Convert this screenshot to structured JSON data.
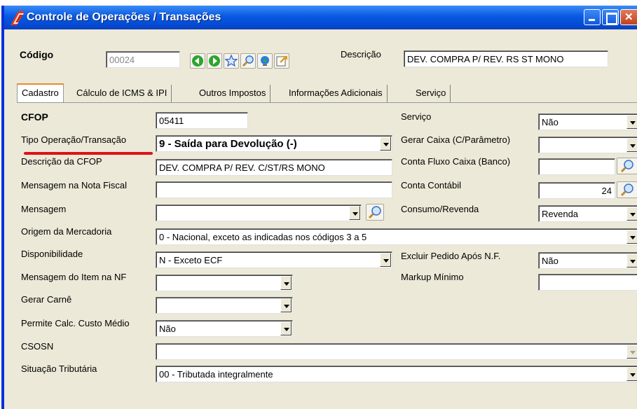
{
  "window": {
    "title": "Controle de Operações / Transações"
  },
  "header": {
    "codigo_label": "Código",
    "codigo_value": "00024",
    "descricao_label": "Descrição",
    "descricao_value": "DEV. COMPRA P/ REV. RS ST MONO",
    "toolbar_icons": [
      "back-icon",
      "forward-icon",
      "star-icon",
      "search-icon",
      "globe-icon",
      "export-icon"
    ]
  },
  "tabs": [
    {
      "label": "Cadastro",
      "active": true
    },
    {
      "label": "Cálculo de ICMS & IPI"
    },
    {
      "label": "Outros Impostos"
    },
    {
      "label": "Informações Adicionais"
    },
    {
      "label": "Serviço"
    }
  ],
  "left": {
    "cfop": {
      "label": "CFOP",
      "value": "05411"
    },
    "tipo_operacao": {
      "label": "Tipo Operação/Transação",
      "value": "9 - Saída para Devolução (-)"
    },
    "descricao_cfop": {
      "label": "Descrição da CFOP",
      "value": "DEV. COMPRA P/ REV. C/ST/RS MONO"
    },
    "mensagem_nf": {
      "label": "Mensagem na Nota Fiscal",
      "value": ""
    },
    "mensagem": {
      "label": "Mensagem",
      "value": ""
    },
    "origem": {
      "label": "Origem da Mercadoria",
      "value": "0 - Nacional, exceto as indicadas nos códigos 3 a 5"
    },
    "disponibilidade": {
      "label": "Disponibilidade",
      "value": "N - Exceto ECF"
    },
    "mensagem_item": {
      "label": "Mensagem do Item na NF",
      "value": ""
    },
    "gerar_carne": {
      "label": "Gerar Carnê",
      "value": ""
    },
    "permite_calc": {
      "label": "Permite Calc. Custo Médio",
      "value": "Não"
    },
    "csosn": {
      "label": "CSOSN",
      "value": ""
    },
    "situacao": {
      "label": "Situação Tributária",
      "value": "00 - Tributada integralmente"
    }
  },
  "right": {
    "servico": {
      "label": "Serviço",
      "value": "Não"
    },
    "gerar_caixa": {
      "label": "Gerar Caixa (C/Parâmetro)",
      "value": ""
    },
    "conta_fluxo": {
      "label": "Conta Fluxo Caixa (Banco)",
      "value": ""
    },
    "conta_contabil": {
      "label": "Conta Contábil",
      "value": "24"
    },
    "consumo": {
      "label": "Consumo/Revenda",
      "value": "Revenda"
    },
    "excluir_pedido": {
      "label": "Excluir Pedido Após N.F.",
      "value": "Não"
    },
    "markup": {
      "label": "Markup Mínimo",
      "value": ""
    }
  },
  "colors": {
    "accent_underline": "#e0101a",
    "titlebar": "#0859e3"
  }
}
